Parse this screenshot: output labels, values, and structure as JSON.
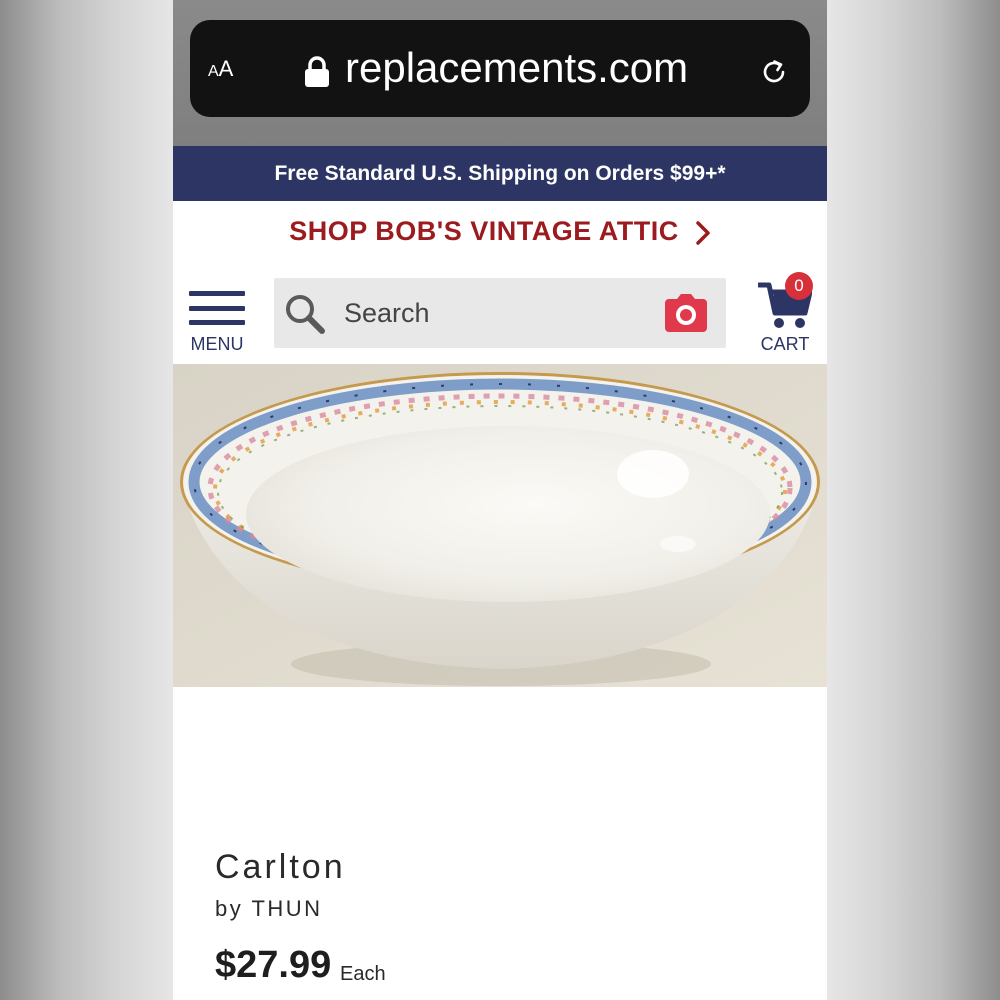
{
  "browser": {
    "text_size_label": "AA",
    "url": "replacements.com"
  },
  "banner": {
    "shipping_text": "Free Standard U.S. Shipping on Orders $99+*"
  },
  "promo": {
    "link_text": "SHOP BOB'S VINTAGE ATTIC"
  },
  "header": {
    "menu_label": "MENU",
    "search_placeholder": "Search",
    "cart_label": "CART",
    "cart_count": "0"
  },
  "product": {
    "name": "Carlton",
    "brand": "by THUN",
    "price": "$27.99",
    "unit": "Each"
  },
  "colors": {
    "navy": "#2c3564",
    "promo_red": "#9b1b1f",
    "badge_red": "#d6313b",
    "camera_red": "#e0394c"
  },
  "icons": [
    "lock-icon",
    "reload-icon",
    "chevron-right-icon",
    "hamburger-icon",
    "search-icon",
    "camera-icon",
    "cart-icon"
  ]
}
